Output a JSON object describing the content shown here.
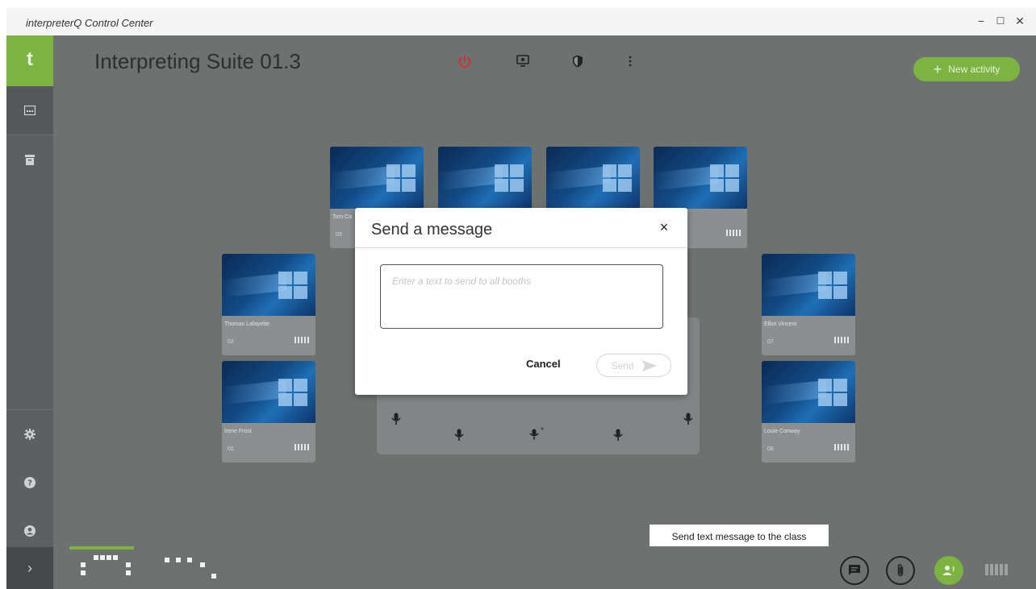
{
  "window": {
    "title": "interpreterQ Control Center",
    "controls": [
      "−",
      "☐",
      "✕"
    ]
  },
  "sidebar": {
    "logo": "t",
    "items": [
      {
        "name": "booths-view-icon"
      },
      {
        "name": "archive-icon"
      },
      {
        "name": "settings-icon"
      },
      {
        "name": "help-icon"
      },
      {
        "name": "user-icon"
      }
    ],
    "expand": "›"
  },
  "header": {
    "title": "Interpreting Suite 01.3",
    "icons": [
      "power-icon",
      "monitor-icon",
      "shield-icon",
      "more-vertical-icon"
    ],
    "new_activity_label": "New activity",
    "power_color": "#d32f2f",
    "accent": "#7cb342"
  },
  "booths": [
    {
      "name": "Tom Ca",
      "num": "03"
    },
    {
      "name": "",
      "num": ""
    },
    {
      "name": "",
      "num": ""
    },
    {
      "name": "",
      "num": ""
    },
    {
      "name": "Thomas Lafayette",
      "num": "02"
    },
    {
      "name": "Irene Frost",
      "num": "01"
    },
    {
      "name": "Elliot Vincent",
      "num": "07"
    },
    {
      "name": "Louie Conway",
      "num": "08"
    }
  ],
  "dialog": {
    "title": "Send a message",
    "close_icon": "×",
    "placeholder": "Enter a text to send to all booths",
    "value": "",
    "cancel_label": "Cancel",
    "send_label": "Send"
  },
  "tooltip": {
    "text": "Send text message to the class"
  },
  "bottombar": {
    "buttons": [
      "chat-icon",
      "attachment-icon",
      "participants-icon"
    ]
  }
}
